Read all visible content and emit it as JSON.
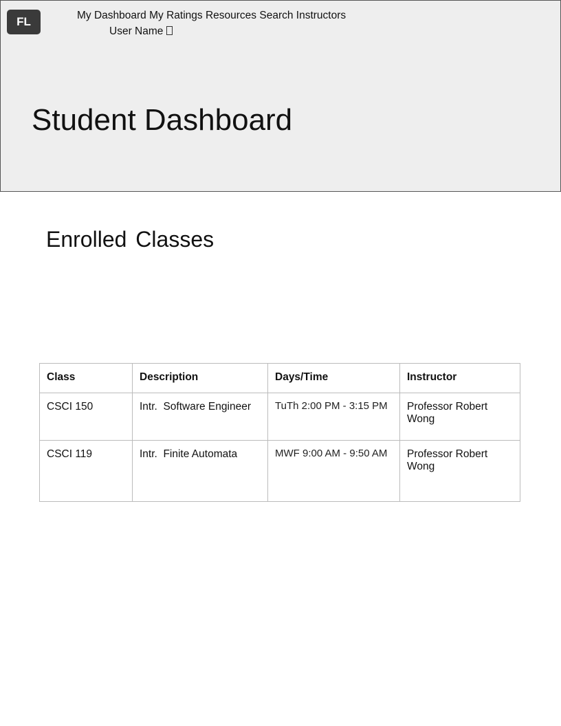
{
  "header": {
    "logo_text": "FL",
    "nav_items": [
      "My Dashboard",
      "My Ratings",
      "Resources",
      "Search Instructors"
    ],
    "user_name": "User Name"
  },
  "hero": {
    "title": "Student Dashboard"
  },
  "main": {
    "section_title": "Enrolled Classes",
    "table": {
      "columns": [
        "Class",
        "Description",
        "Days/Time",
        "Instructor"
      ],
      "rows": [
        [
          "CSCI 150",
          "Intr.  Software Engineer",
          "TuTh 2:00 PM - 3:15 PM",
          "Professor Robert Wong"
        ],
        [
          "CSCI 119",
          "Intr.  Finite Automata",
          "MWF 9:00 AM - 9:50 AM",
          "Professor Robert Wong"
        ]
      ]
    }
  },
  "colors": {
    "header_bg": "#eeeeee",
    "logo_bg": "#3a3a3a",
    "border": "#555555",
    "table_border": "#bbbbbb"
  }
}
